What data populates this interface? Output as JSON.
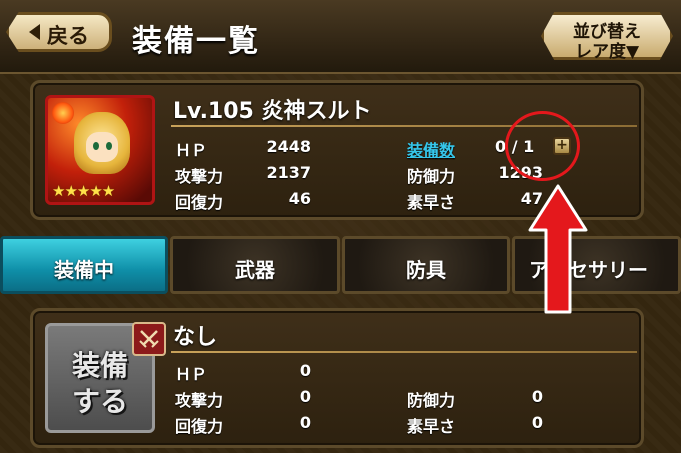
{
  "header": {
    "back_label": "戻る",
    "title": "装備一覧",
    "sort_label_1": "並び替え",
    "sort_label_2": "レア度▼"
  },
  "character": {
    "name": "Lv.105 炎神スルト",
    "stars": "★★★★★",
    "stats": {
      "hp_label": "ＨＰ",
      "hp_value": "2448",
      "attack_label": "攻撃力",
      "attack_value": "2137",
      "recovery_label": "回復力",
      "recovery_value": "46",
      "equip_count_label": "装備数",
      "equip_count_value": "0 / 1",
      "defense_label": "防御力",
      "defense_value": "1293",
      "speed_label": "素早さ",
      "speed_value": "47"
    },
    "plus_label": "+"
  },
  "tabs": [
    {
      "label": "装備中",
      "active": true
    },
    {
      "label": "武器",
      "active": false
    },
    {
      "label": "防具",
      "active": false
    },
    {
      "label": "アクセサリー",
      "active": false
    }
  ],
  "equipment": {
    "slot_line1": "装備",
    "slot_line2": "する",
    "name": "なし",
    "stats": {
      "hp_label": "ＨＰ",
      "hp_value": "0",
      "attack_label": "攻撃力",
      "attack_value": "0",
      "recovery_label": "回復力",
      "recovery_value": "0",
      "defense_label": "防御力",
      "defense_value": "0",
      "speed_label": "素早さ",
      "speed_value": "0"
    }
  },
  "colors": {
    "active_tab": "#17a7c0",
    "equip_count_link": "#36c6ea",
    "annotation_red": "#e4181c",
    "portrait_frame": "#b01414"
  }
}
